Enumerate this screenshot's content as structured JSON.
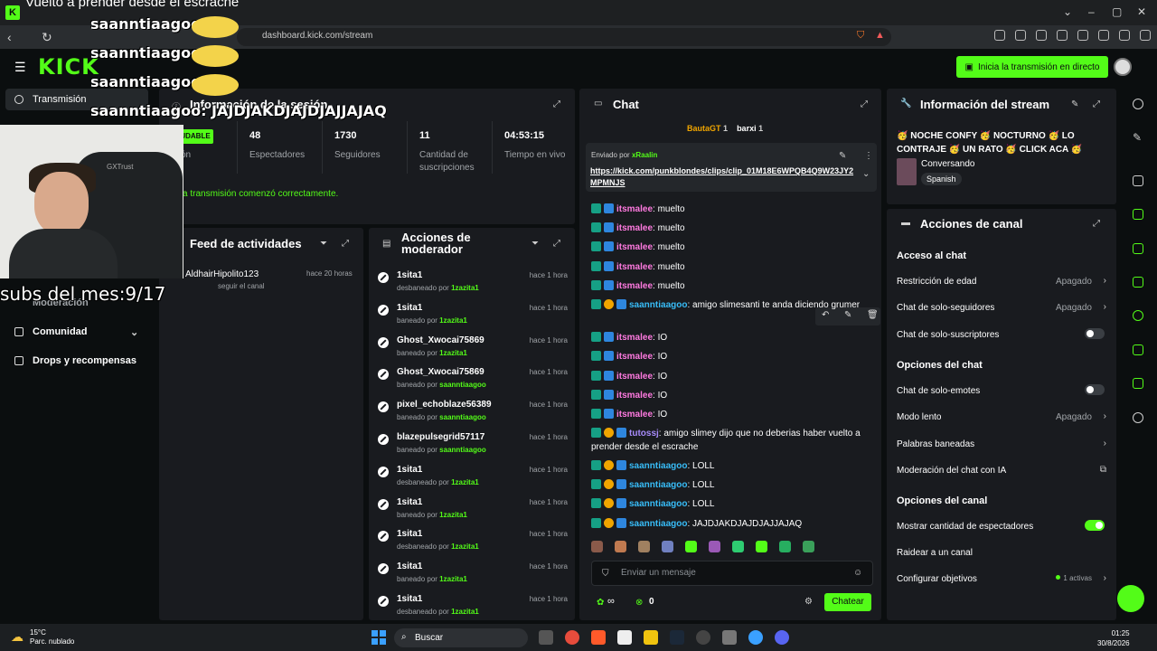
{
  "browser": {
    "window_title": "Vuelto a prender desde el escrache",
    "url": "dashboard.kick.com/stream"
  },
  "header": {
    "live_button": "Inicia la transmisión en directo"
  },
  "leftnav": {
    "items": [
      {
        "label": "Transmisión"
      },
      {
        "label": "Moderación"
      },
      {
        "label": "Comunidad"
      },
      {
        "label": "Drops y recompensas"
      }
    ]
  },
  "session": {
    "title": "Información de la sesión",
    "badge": "UDABLE",
    "stats": [
      {
        "value": "48",
        "label": "Espectadores"
      },
      {
        "value": "1730",
        "label": "Seguidores"
      },
      {
        "value": "11",
        "label": "Cantidad de suscripciones"
      },
      {
        "value": "04:53:15",
        "label": "Tiempo en vivo"
      }
    ],
    "stat_first_label": "ón",
    "message": "a transmisión comenzó correctamente."
  },
  "activity": {
    "title": "Feed de actividades",
    "entries": [
      {
        "name": "AldhairHipolito123",
        "time": "hace 20 horas",
        "sub": "seguir el canal"
      }
    ]
  },
  "moderator": {
    "title": "Acciones de moderador",
    "rows": [
      {
        "user": "1sita1",
        "action": "desbaneado por",
        "by": "1zazita1",
        "time": "hace 1 hora"
      },
      {
        "user": "1sita1",
        "action": "baneado por",
        "by": "1zazita1",
        "time": "hace 1 hora"
      },
      {
        "user": "Ghost_Xwocai75869",
        "action": "baneado por",
        "by": "1zazita1",
        "time": "hace 1 hora"
      },
      {
        "user": "Ghost_Xwocai75869",
        "action": "baneado por",
        "by": "saanntiaagoo",
        "time": "hace 1 hora"
      },
      {
        "user": "pixel_echoblaze56389",
        "action": "baneado por",
        "by": "saanntiaagoo",
        "time": "hace 1 hora"
      },
      {
        "user": "blazepulsegrid57117",
        "action": "baneado por",
        "by": "saanntiaagoo",
        "time": "hace 1 hora"
      },
      {
        "user": "1sita1",
        "action": "desbaneado por",
        "by": "1zazita1",
        "time": "hace 1 hora"
      },
      {
        "user": "1sita1",
        "action": "baneado por",
        "by": "1zazita1",
        "time": "hace 1 hora"
      },
      {
        "user": "1sita1",
        "action": "desbaneado por",
        "by": "1zazita1",
        "time": "hace 1 hora"
      },
      {
        "user": "1sita1",
        "action": "baneado por",
        "by": "1zazita1",
        "time": "hace 1 hora"
      },
      {
        "user": "1sita1",
        "action": "desbaneado por",
        "by": "1zazita1",
        "time": "hace 1 hora"
      }
    ]
  },
  "chat": {
    "title": "Chat",
    "top_gifters": [
      {
        "name": "BautaGT",
        "count": "1"
      },
      {
        "name": "barxi",
        "count": "1"
      }
    ],
    "pinned": {
      "sent_by_label": "Enviado por",
      "sender": "xRaalin",
      "link": "https://kick.com/punkblondes/clips/clip_01M18E6WPQB4Q9W23JY2MPMNJS"
    },
    "messages": [
      {
        "user": "itsmalee",
        "text": "muelto",
        "color": "pink"
      },
      {
        "user": "itsmalee",
        "text": "muelto",
        "color": "pink"
      },
      {
        "user": "itsmalee",
        "text": "muelto",
        "color": "pink"
      },
      {
        "user": "itsmalee",
        "text": "muelto",
        "color": "pink"
      },
      {
        "user": "itsmalee",
        "text": "muelto",
        "color": "pink"
      },
      {
        "user": "saanntiaagoo",
        "text": "amigo slimesanti te anda diciendo grumer",
        "color": "blue"
      },
      {
        "user": "itsmalee",
        "text": "IO",
        "color": "pink"
      },
      {
        "user": "itsmalee",
        "text": "IO",
        "color": "pink"
      },
      {
        "user": "itsmalee",
        "text": "IO",
        "color": "pink"
      },
      {
        "user": "itsmalee",
        "text": "IO",
        "color": "pink"
      },
      {
        "user": "itsmalee",
        "text": "IO",
        "color": "pink"
      },
      {
        "user": "tutossj",
        "text": "amigo slimey dijo que no deberias haber vuelto a prender desde el escrache",
        "color": "purple"
      },
      {
        "user": "saanntiaagoo",
        "text": "LOLL",
        "color": "blue"
      },
      {
        "user": "saanntiaagoo",
        "text": "LOLL",
        "color": "blue"
      },
      {
        "user": "saanntiaagoo",
        "text": "LOLL",
        "color": "blue"
      },
      {
        "user": "saanntiaagoo",
        "text": "JAJDJAKDJAJDJAJJAJAQ",
        "color": "blue"
      }
    ],
    "input_placeholder": "Enviar un mensaje",
    "send_button": "Chatear",
    "footer_points": "∞",
    "footer_count": "0"
  },
  "stream_info": {
    "title": "Información del stream",
    "stream_title": "🥳 NOCHE CONFY 🥳 NOCTURNO 🥳 LO CONTRAJE 🥳 UN RATO 🥳 CLICK ACA 🥳 YA...",
    "category": "Conversando",
    "language": "Spanish"
  },
  "channel_actions": {
    "title": "Acciones de canal",
    "sections": [
      {
        "heading": "Acceso al chat",
        "rows": [
          {
            "label": "Restricción de edad",
            "value": "Apagado",
            "type": "select"
          },
          {
            "label": "Chat de solo-seguidores",
            "value": "Apagado",
            "type": "select"
          },
          {
            "label": "Chat de solo-suscriptores",
            "value": "",
            "type": "toggle-off"
          }
        ]
      },
      {
        "heading": "Opciones del chat",
        "rows": [
          {
            "label": "Chat de solo-emotes",
            "value": "",
            "type": "toggle-off"
          },
          {
            "label": "Modo lento",
            "value": "Apagado",
            "type": "select"
          },
          {
            "label": "Palabras baneadas",
            "value": "",
            "type": "link"
          },
          {
            "label": "Moderación del chat con IA",
            "value": "",
            "type": "external"
          }
        ]
      },
      {
        "heading": "Opciones del canal",
        "rows": [
          {
            "label": "Mostrar cantidad de espectadores",
            "value": "",
            "type": "toggle-on"
          },
          {
            "label": "Raidear a un canal",
            "value": "",
            "type": "none"
          },
          {
            "label": "Configurar objetivos",
            "value": "1 activas",
            "type": "goals"
          }
        ]
      }
    ]
  },
  "overlay": {
    "lines": [
      "saanntiaagoo:",
      "saanntiaagoo:",
      "saanntiaagoo:",
      "saanntiaagoo: JAJDJAKDJAJDJAJJAJAQ"
    ],
    "subs_counter": "subs del mes:9/17",
    "cam_brand": "GXTrust",
    "logo": "KICK"
  },
  "taskbar": {
    "temperature": "15°C",
    "weather": "Parc. nublado",
    "search": "Buscar",
    "time": "01:25",
    "date": "30/8/2026"
  }
}
